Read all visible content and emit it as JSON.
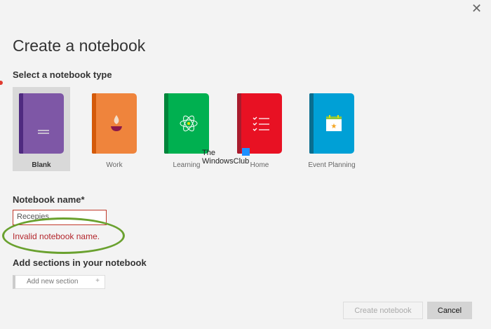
{
  "dialog": {
    "title": "Create a notebook",
    "close_icon": "close-icon"
  },
  "types": {
    "heading": "Select a notebook type",
    "items": [
      {
        "label": "Blank",
        "color": "#7e57a6",
        "spine": "#4f2a80",
        "icon": "lines-icon",
        "selected": true
      },
      {
        "label": "Work",
        "color": "#ef843c",
        "spine": "#d45a0a",
        "icon": "coffee-cup-icon"
      },
      {
        "label": "Learning",
        "color": "#00b050",
        "spine": "#00853a",
        "icon": "atom-icon"
      },
      {
        "label": "Home",
        "color": "#e81123",
        "spine": "#a81b2d",
        "icon": "checklist-icon"
      },
      {
        "label": "Event Planning",
        "color": "#00a0d6",
        "spine": "#0a6e8f",
        "icon": "calendar-star-icon"
      }
    ]
  },
  "watermark": {
    "line1": "The",
    "line2": "WindowsClub"
  },
  "name": {
    "label": "Notebook name*",
    "value": "Recepies",
    "error": "Invalid notebook name."
  },
  "sections": {
    "heading": "Add sections in your notebook",
    "add_label": "Add new section",
    "plus": "+"
  },
  "buttons": {
    "create": "Create notebook",
    "cancel": "Cancel"
  }
}
